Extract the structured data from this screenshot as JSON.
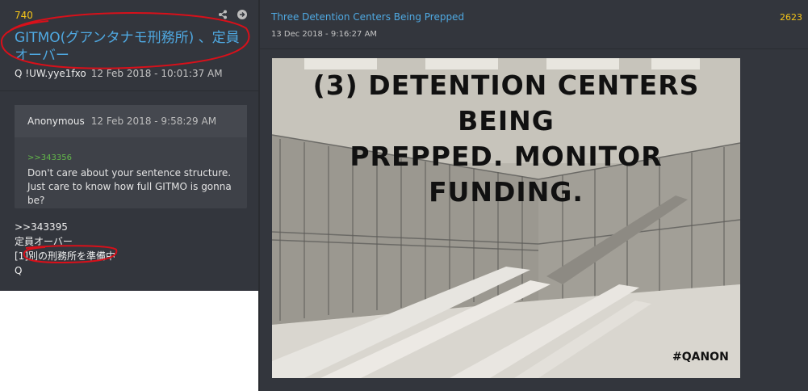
{
  "left_post": {
    "number": "740",
    "title": "GITMO(グアンタナモ刑務所) 、定員オーバー",
    "author": "Q  !UW.yye1fxo",
    "date": "12 Feb 2018 - 10:01:37 AM",
    "quote": {
      "name": "Anonymous",
      "date": "12 Feb 2018 - 9:58:29 AM",
      "link": ">>343356",
      "text": "Don't care about your sentence structure. Just care to know how full GITMO is gonna be?"
    },
    "body": {
      "line1": ">>343395",
      "line2": "定員オーバー",
      "line3_prefix": "[1]",
      "line3_rest": "別の刑務所を準備中",
      "line4": "Q"
    }
  },
  "right_post": {
    "title": "Three Detention Centers Being Prepped",
    "date": "13 Dec 2018 - 9:16:27 AM",
    "number": "2623",
    "image": {
      "caption_line1": "(3) DETENTION CENTERS BEING",
      "caption_line2": "PREPPED.  MONITOR FUNDING.",
      "hashtag": "#QANON"
    }
  },
  "colors": {
    "accent_blue": "#4fa9e2",
    "number_yellow": "#f5c518",
    "annotation_red": "#d8101a",
    "panel_bg": "#33363d"
  },
  "icons": [
    "share-icon",
    "arrow-right-icon"
  ]
}
